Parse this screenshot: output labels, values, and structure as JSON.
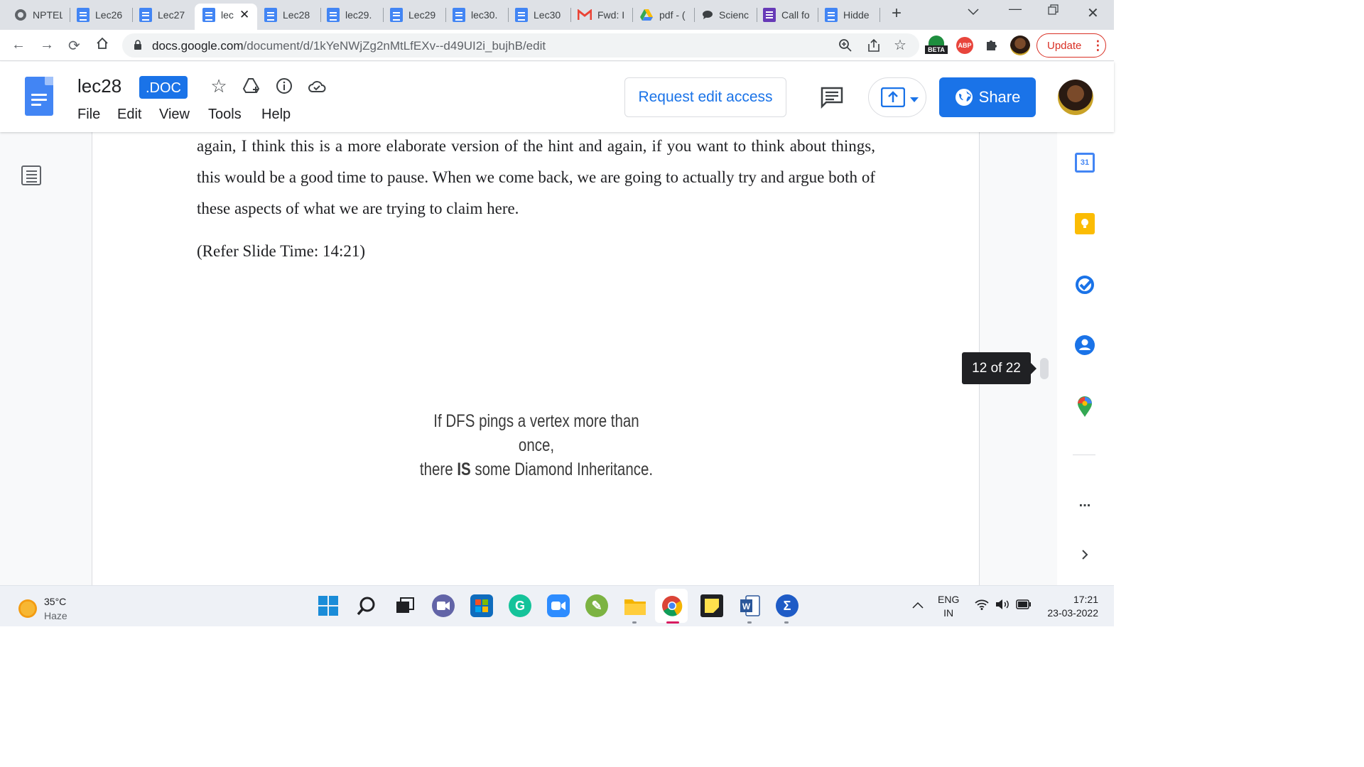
{
  "browser": {
    "tabs": [
      {
        "title": "NPTEL",
        "icon": "globe-icon"
      },
      {
        "title": "Lec26",
        "icon": "docs-icon"
      },
      {
        "title": "Lec27",
        "icon": "docs-icon"
      },
      {
        "title": "lec",
        "icon": "docs-icon",
        "active": true
      },
      {
        "title": "Lec28",
        "icon": "docs-icon"
      },
      {
        "title": "lec29.",
        "icon": "docs-icon"
      },
      {
        "title": "Lec29",
        "icon": "docs-icon"
      },
      {
        "title": "lec30.",
        "icon": "docs-icon"
      },
      {
        "title": "Lec30",
        "icon": "docs-icon"
      },
      {
        "title": "Fwd: I",
        "icon": "gmail-icon"
      },
      {
        "title": "pdf - (",
        "icon": "drive-icon"
      },
      {
        "title": "Scienc",
        "icon": "chat-icon"
      },
      {
        "title": "Call fo",
        "icon": "forms-icon"
      },
      {
        "title": "Hidde",
        "icon": "docs-icon"
      }
    ],
    "url_host": "docs.google.com",
    "url_path": "/document/d/1kYeNWjZg2nMtLfEXv--d49UI2i_bujhB/edit",
    "update_label": "Update",
    "beta_label": "BETA",
    "abp_label": "ABP"
  },
  "docs": {
    "title": "lec28",
    "badge": ".DOC",
    "menu": [
      "File",
      "Edit",
      "View",
      "Tools",
      "Help"
    ],
    "request_edit_label": "Request edit access",
    "share_label": "Share"
  },
  "document": {
    "paragraph_1": "again, I think this is a more elaborate version of the hint and again, if you want to think about things, this would be a good time to pause. When we come back, we are going to actually try and argue both of these aspects of what we are trying to claim here.",
    "paragraph_2": "(Refer Slide Time: 14:21)",
    "slide_line_1": "If DFS pings a vertex more than once,",
    "slide_line_2_pre": "there ",
    "slide_line_2_bold": "IS",
    "slide_line_2_post": " some Diamond Inheritance."
  },
  "page_indicator": "12 of 22",
  "side_panel": {
    "calendar_day": "31",
    "more_label": "..."
  },
  "taskbar": {
    "temperature": "35°C",
    "condition": "Haze",
    "lang_1": "ENG",
    "lang_2": "IN",
    "time": "17:21",
    "date": "23-03-2022"
  },
  "colors": {
    "accent": "#1a73e8",
    "docs_blue": "#4285f4",
    "update_red": "#d93025"
  }
}
